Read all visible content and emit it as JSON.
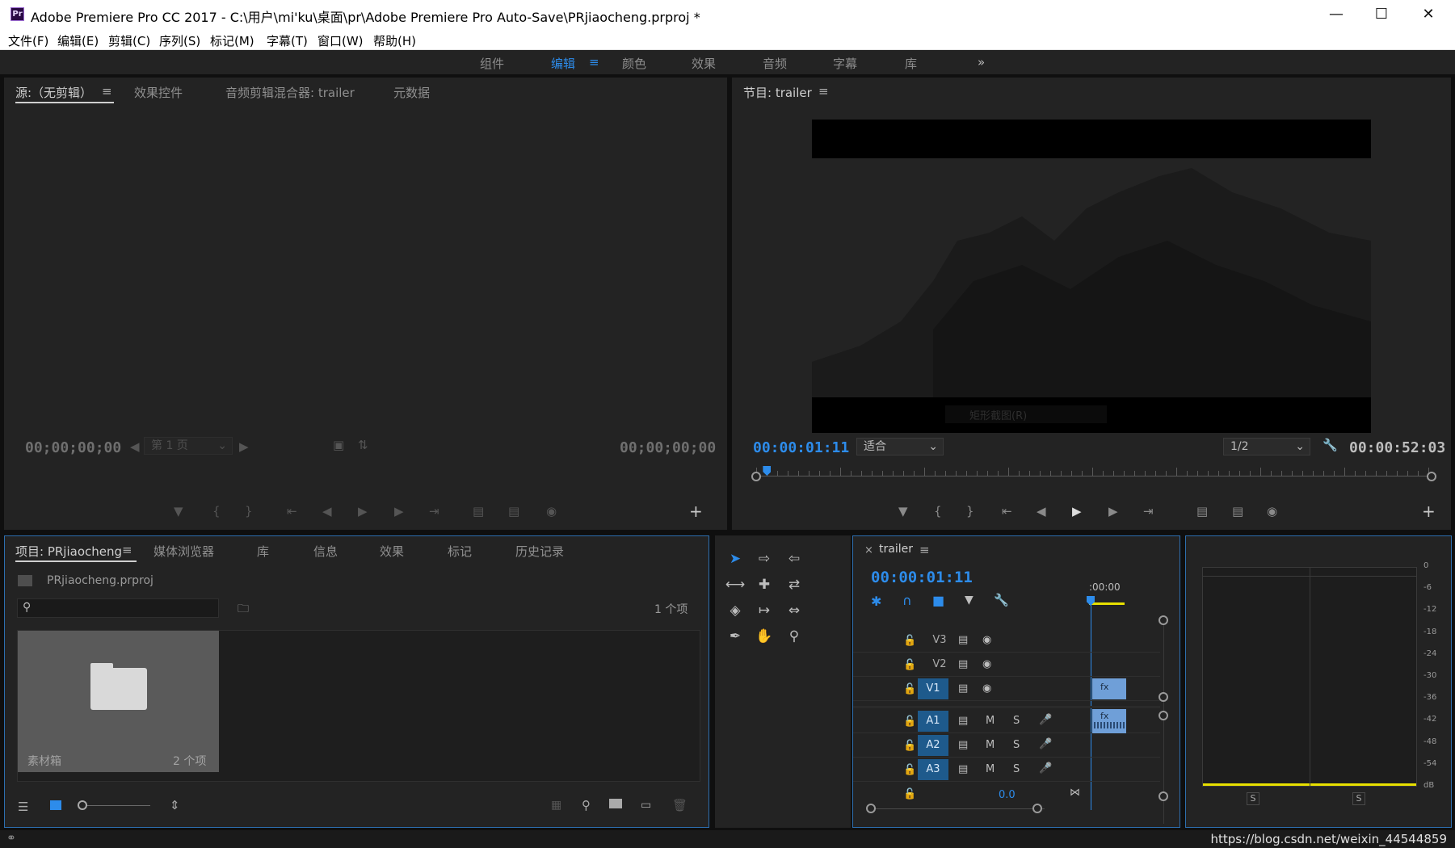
{
  "window": {
    "app_icon": "Pr",
    "title": "Adobe Premiere Pro CC 2017 - C:\\用户\\mi'ku\\桌面\\pr\\Adobe Premiere Pro Auto-Save\\PRjiaocheng.prproj *",
    "minimize_icon": "minimize-icon",
    "maximize_icon": "maximize-icon",
    "close_icon": "close-icon"
  },
  "menu": [
    "文件(F)",
    "编辑(E)",
    "剪辑(C)",
    "序列(S)",
    "标记(M)",
    "字幕(T)",
    "窗口(W)",
    "帮助(H)"
  ],
  "workspaces": {
    "items": [
      "组件",
      "编辑",
      "颜色",
      "效果",
      "音频",
      "字幕",
      "库"
    ],
    "active": "编辑",
    "more": "»"
  },
  "source_panel": {
    "tabs": [
      "源:（无剪辑）",
      "效果控件",
      "音频剪辑混合器: trailer",
      "元数据"
    ],
    "timecode_in": "00;00;00;00",
    "timecode_out": "00;00;00;00",
    "page_select": "第 1 页"
  },
  "program_panel": {
    "title": "节目: trailer",
    "overlay_menu": "矩形截图(R)",
    "timecode": "00:00:01:11",
    "fit": "适合",
    "resolution": "1/2",
    "duration": "00:00:52:03",
    "playhead_fraction": 0.01
  },
  "project_panel": {
    "tabs": [
      "项目: PRjiaocheng",
      "媒体浏览器",
      "库",
      "信息",
      "效果",
      "标记",
      "历史记录"
    ],
    "project_file": "PRjiaocheng.prproj",
    "search_placeholder": "",
    "item_count": "1 个项",
    "bin": {
      "name": "素材箱",
      "count": "2 个项"
    }
  },
  "tools_panel": {
    "tools": [
      [
        "selection-tool",
        "track-select-forward-tool",
        "track-select-backward-tool"
      ],
      [
        "ripple-edit-tool",
        "rolling-edit-tool",
        "rate-stretch-tool"
      ],
      [
        "razor-tool",
        "slip-tool",
        "slide-tool"
      ],
      [
        "pen-tool",
        "hand-tool",
        "zoom-tool"
      ]
    ]
  },
  "timeline_panel": {
    "sequence_name": "trailer",
    "timecode": "00:00:01:11",
    "ruler_label": ":00:00",
    "video_tracks": [
      "V3",
      "V2",
      "V1"
    ],
    "audio_tracks": [
      "A1",
      "A2",
      "A3"
    ],
    "mute_label": "M",
    "solo_label": "S",
    "clip_fx_label": "fx",
    "master_value": "0.0"
  },
  "audio_meter": {
    "scale": [
      "0",
      "-6",
      "-12",
      "-18",
      "-24",
      "-30",
      "-36",
      "-42",
      "-48",
      "-54",
      "dB"
    ],
    "solo_left": "S",
    "solo_right": "S"
  },
  "footer": {
    "watermark": "https://blog.csdn.net/weixin_44544859"
  },
  "colors": {
    "accent": "#2d8ceb",
    "panel_bg": "#232323",
    "track_blue": "#1e5a8c",
    "clip_blue": "#6f9fd8",
    "work_area_yellow": "#e8e000"
  }
}
